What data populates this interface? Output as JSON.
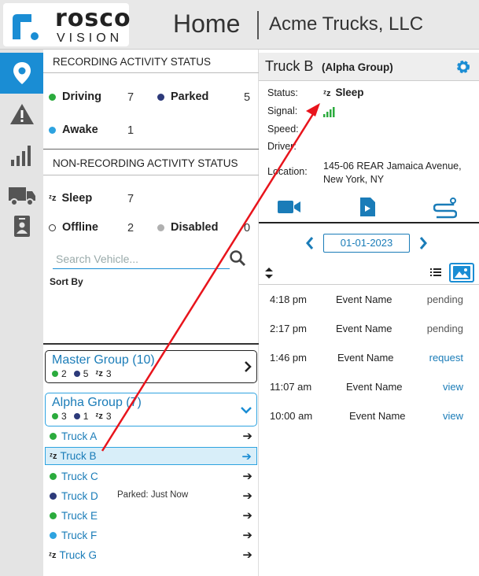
{
  "header": {
    "logo_top": "rosco",
    "logo_bottom": "VISION",
    "title": "Home",
    "company": "Acme Trucks, LLC"
  },
  "colors": {
    "accent": "#1a8dd4",
    "driving": "#2bab3d",
    "parked": "#2d3a7a",
    "awake": "#2ea3e0",
    "disabled": "#b0b0b0",
    "link": "#1a7cb8"
  },
  "nav": {
    "items": [
      "location-pin-icon",
      "alert-icon",
      "signal-icon",
      "truck-icon",
      "badge-icon"
    ]
  },
  "recording": {
    "title": "RECORDING ACTIVITY STATUS",
    "driving_label": "Driving",
    "driving": "7",
    "parked_label": "Parked",
    "parked": "5",
    "awake_label": "Awake",
    "awake": "1"
  },
  "nonrecording": {
    "title": "NON-RECORDING ACTIVITY STATUS",
    "sleep_label": "Sleep",
    "sleep": "7",
    "offline_label": "Offline",
    "offline": "2",
    "disabled_label": "Disabled",
    "disabled": "0"
  },
  "search": {
    "placeholder": "Search Vehicle...",
    "sort_label": "Sort By"
  },
  "groups": [
    {
      "name": "Master Group (10)",
      "c1": "2",
      "c2": "5",
      "c3": "3"
    },
    {
      "name": "Alpha Group (7)",
      "c1": "3",
      "c2": "1",
      "c3": "3"
    }
  ],
  "trucks": [
    {
      "name": "Truck A",
      "status": "driving",
      "note": ""
    },
    {
      "name": "Truck B",
      "status": "sleep",
      "note": ""
    },
    {
      "name": "Truck C",
      "status": "driving",
      "note": ""
    },
    {
      "name": "Truck D",
      "status": "parked",
      "note": "Parked: Just Now"
    },
    {
      "name": "Truck E",
      "status": "driving",
      "note": ""
    },
    {
      "name": "Truck F",
      "status": "awake",
      "note": ""
    },
    {
      "name": "Truck G",
      "status": "sleep",
      "note": ""
    }
  ],
  "detail": {
    "title": "Truck B",
    "group": "(Alpha Group)",
    "status_label": "Status:",
    "status": "Sleep",
    "signal_label": "Signal:",
    "speed_label": "Speed:",
    "driver_label": "Driver:",
    "location_label": "Location:",
    "location": "145-06 REAR Jamaica Avenue, New York, NY"
  },
  "date": "01-01-2023",
  "events": [
    {
      "time": "4:18 pm",
      "name": "Event Name",
      "status": "pending"
    },
    {
      "time": "2:17 pm",
      "name": "Event Name",
      "status": "pending"
    },
    {
      "time": "1:46 pm",
      "name": "Event Name",
      "status": "request"
    },
    {
      "time": "11:07 am",
      "name": "Event Name",
      "status": "view"
    },
    {
      "time": "10:00 am",
      "name": "Event Name",
      "status": "view"
    }
  ]
}
